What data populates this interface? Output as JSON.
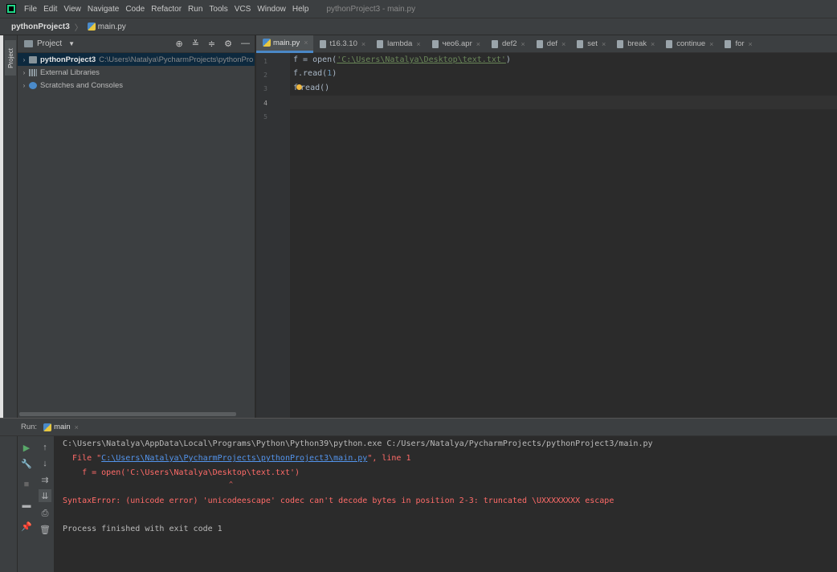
{
  "menubar": {
    "items": [
      "File",
      "Edit",
      "View",
      "Navigate",
      "Code",
      "Refactor",
      "Run",
      "Tools",
      "VCS",
      "Window",
      "Help"
    ],
    "window_title": "pythonProject3 - main.py"
  },
  "breadcrumbs": {
    "project": "pythonProject3",
    "file": "main.py"
  },
  "project_panel": {
    "stripe_label": "Project",
    "header_label": "Project",
    "tree": [
      {
        "name": "pythonProject3",
        "path": "C:\\Users\\Natalya\\PycharmProjects\\pythonPro"
      },
      {
        "name": "External Libraries"
      },
      {
        "name": "Scratches and Consoles"
      }
    ]
  },
  "editor_tabs": [
    "main.py",
    "t16.3.10",
    "lambda",
    "чео6.apr",
    "def2",
    "def",
    "set",
    "break",
    "continue",
    "for"
  ],
  "editor": {
    "line_numbers": [
      "1",
      "2",
      "3",
      "4",
      "5"
    ],
    "code": {
      "l1_pre": "f = open(",
      "l1_str": "'C:\\Users\\Natalya\\Desktop\\text.txt'",
      "l1_post": ")",
      "l2_pre": "f.read(",
      "l2_num": "1",
      "l2_post": ")",
      "l3_pre": "f",
      "l3_post": "read()"
    }
  },
  "run_panel": {
    "label": "Run:",
    "tab": "main",
    "console": {
      "cmd": "C:\\Users\\Natalya\\AppData\\Local\\Programs\\Python\\Python39\\python.exe C:/Users/Natalya/PycharmProjects/pythonProject3/main.py",
      "file_pre": "  File \"",
      "file_link": "C:\\Users\\Natalya\\PycharmProjects\\pythonProject3\\main.py",
      "file_post": "\", line 1",
      "code_line": "    f = open('C:\\Users\\Natalya\\Desktop\\text.txt')",
      "caret": "                                           ^",
      "error": "SyntaxError: (unicode error) 'unicodeescape' codec can't decode bytes in position 2-3: truncated \\UXXXXXXXX escape",
      "exit": "Process finished with exit code 1"
    }
  },
  "colors": {
    "accent": "#4a88c7",
    "error": "#ff6b68",
    "link": "#5394ec",
    "string": "#6a8759"
  }
}
